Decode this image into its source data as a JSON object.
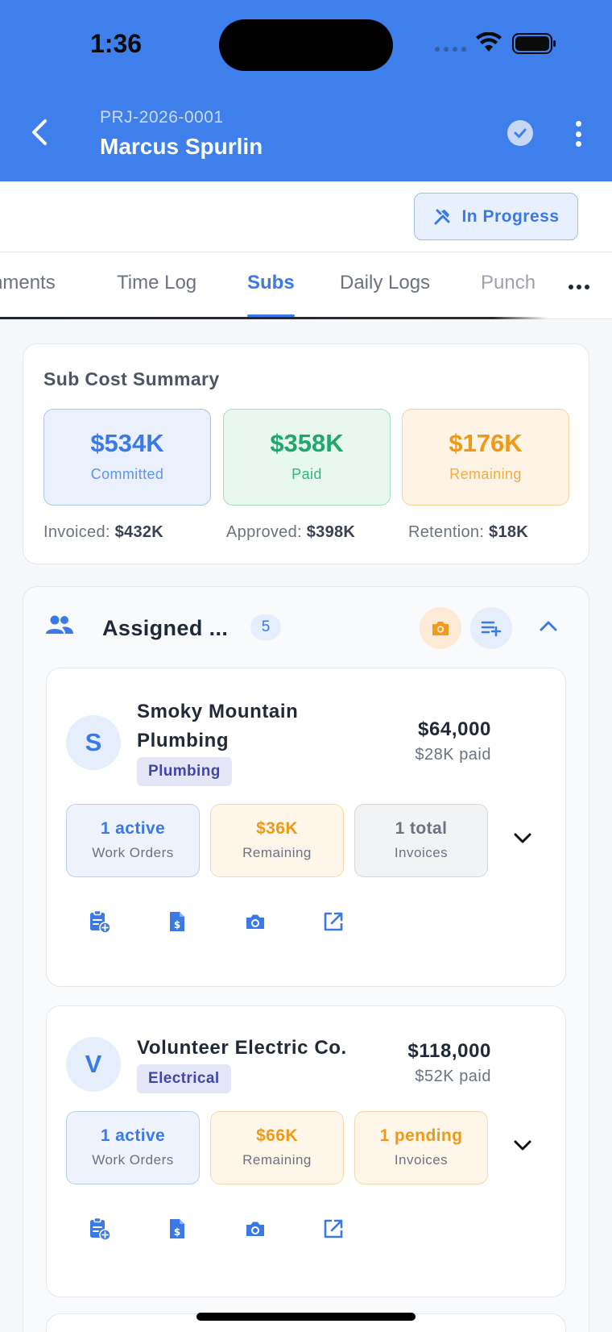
{
  "status_bar": {
    "time": "1:36"
  },
  "header": {
    "project_code": "PRJ-2026-0001",
    "project_name": "Marcus Spurlin"
  },
  "status": {
    "label": "In Progress"
  },
  "tabs": [
    {
      "label": "nments"
    },
    {
      "label": "Time Log"
    },
    {
      "label": "Subs"
    },
    {
      "label": "Daily Logs"
    },
    {
      "label": "Punch"
    }
  ],
  "summary": {
    "title": "Sub Cost Summary",
    "committed": {
      "value": "$534K",
      "label": "Committed"
    },
    "paid": {
      "value": "$358K",
      "label": "Paid"
    },
    "remaining": {
      "value": "$176K",
      "label": "Remaining"
    },
    "invoiced": {
      "label": "Invoiced:",
      "value": "$432K"
    },
    "approved": {
      "label": "Approved:",
      "value": "$398K"
    },
    "retention": {
      "label": "Retention:",
      "value": "$18K"
    }
  },
  "assigned": {
    "title": "Assigned ...",
    "count": "5"
  },
  "subs": [
    {
      "initial": "S",
      "name_line1": "Smoky Mountain",
      "name_line2": "Plumbing",
      "trade": "Plumbing",
      "amount": "$64,000",
      "paid": "$28K paid",
      "work_orders": {
        "value": "1 active",
        "label": "Work Orders"
      },
      "remaining": {
        "value": "$36K",
        "label": "Remaining"
      },
      "invoices": {
        "value": "1 total",
        "label": "Invoices"
      }
    },
    {
      "initial": "V",
      "name_line1": "Volunteer Electric Co.",
      "trade": "Electrical",
      "amount": "$118,000",
      "paid": "$52K paid",
      "work_orders": {
        "value": "1 active",
        "label": "Work Orders"
      },
      "remaining": {
        "value": "$66K",
        "label": "Remaining"
      },
      "invoices": {
        "value": "1 pending",
        "label": "Invoices"
      }
    }
  ],
  "colors": {
    "primary": "#3e7fec",
    "green": "#1fa86a",
    "orange": "#ee9a16",
    "indigo": "#4147a8"
  }
}
